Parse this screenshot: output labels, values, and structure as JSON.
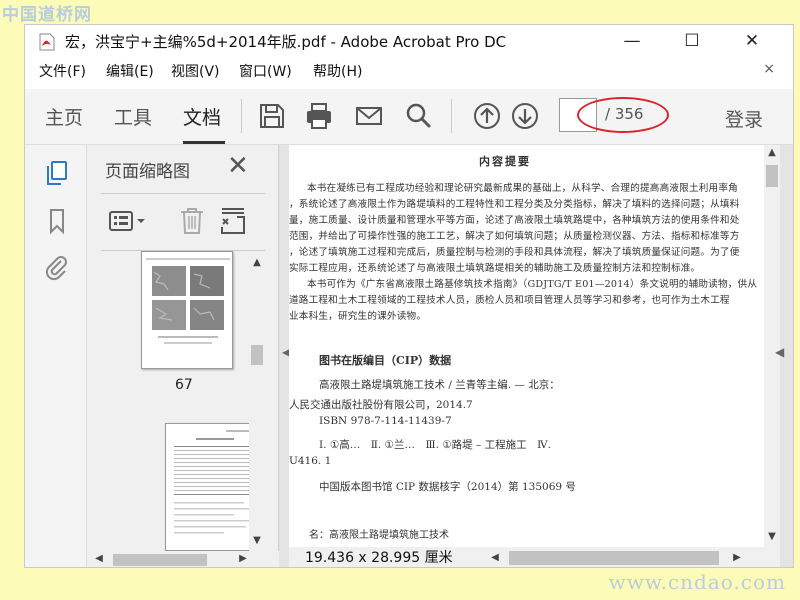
{
  "watermarks": {
    "top": "中国道桥网",
    "bottom": "www.cndao.com"
  },
  "window": {
    "title": "宏，洪宝宁+主编%5d+2014年版.pdf - Adobe Acrobat Pro DC",
    "minimize": "—",
    "maximize": "☐",
    "close": "✕"
  },
  "menubar": {
    "items": [
      "文件(F)",
      "编辑(E)",
      "视图(V)",
      "窗口(W)",
      "帮助(H)"
    ],
    "close": "×"
  },
  "toolbar": {
    "tabs": [
      "主页",
      "工具",
      "文档"
    ],
    "active_tab": "文档",
    "icons": [
      "save-icon",
      "print-icon",
      "email-icon",
      "search-icon",
      "previous-page-icon",
      "next-page-icon"
    ],
    "page_input_value": "",
    "page_total": "/ 356",
    "login": "登录"
  },
  "left_rail": {
    "icons": [
      "page-thumbnails-icon",
      "bookmarks-icon",
      "attachments-icon"
    ]
  },
  "thumbnails_pane": {
    "title": "页面缩略图",
    "close": "✕",
    "page_label": "67"
  },
  "document": {
    "heading": "内容提要",
    "paragraph_lines": [
      "本书在凝练已有工程成功经验和理论研究最新成果的基础上，从科学、合理的提高高液限土利用率角",
      "，系统论述了高液限土作为路堤填料的工程特性和工程分类及分类指标，解决了填料的选择问题；从填料",
      "量，施工质量、设计质量和管理水平等方面，论述了高液限土填筑路堤中，各种填筑方法的使用条件和处",
      "范围，并给出了可操作性强的施工工艺，解决了如何填筑问题；从质量检测仪器、方法、指标和标准等方",
      "，论述了填筑施工过程和完成后，质量控制与检测的手段和具体流程，解决了填筑质量保证问题。为了便",
      "实际工程应用，还系统论述了与高液限土填筑路堤相关的辅助施工及质量控制方法和控制标准。",
      "本书可作为《广东省高液限土路基修筑技术指南》（GDJTG/T E01—2014）条文说明的辅助读物，供从",
      "道路工程和土木工程领域的工程技术人员，质检人员和项目管理人员等学习和参考，也可作为土木工程",
      "业本科生，研究生的课外读物。"
    ],
    "cip_title": "图书在版编目（CIP）数据",
    "cip_lines": [
      "高液限土路堤填筑施工技术 / 兰青等主编. — 北京：",
      "人民交通出版社股份有限公司，2014.7",
      "ISBN 978-7-114-11439-7",
      "Ⅰ. ①高…　Ⅱ. ①兰…　Ⅲ. ①路堤 – 工程施工　Ⅳ.",
      "U416. 1",
      "中国版本图书馆 CIP 数据核字（2014）第 135069 号"
    ],
    "footer_line": "名：高液限土路堤填筑施工技术",
    "page_size": "19.436 x 28.995 厘米"
  },
  "colors": {
    "page_background": "#fdfbb8",
    "annotation_oval": "#d8262b",
    "active_icon": "#2a7ac9"
  }
}
